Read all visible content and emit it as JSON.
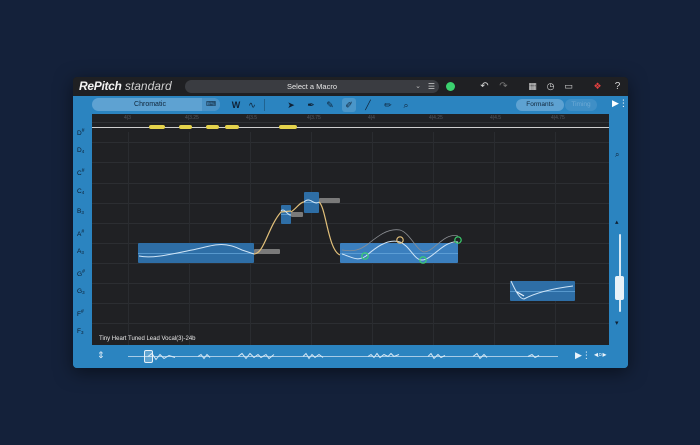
{
  "app": {
    "title_bold": "RePitch",
    "title_light": "standard"
  },
  "macro": {
    "label": "Select a Macro",
    "chevron_icon": "chevron-down-icon",
    "settings_icon": "sliders-icon"
  },
  "titlebar": {
    "status_color": "#3bd16f",
    "icons": [
      "undo-icon",
      "redo-icon",
      "grid-icon",
      "clock-icon",
      "monitor-icon",
      "plugin-badge-icon",
      "help-icon"
    ],
    "help_label": "?"
  },
  "toolbar": {
    "scale": "Chromatic",
    "formants_label": "Formants",
    "timing_label": "Timing",
    "tools": [
      "wave-tool-icon",
      "audio-tool-icon",
      "pointer-tool-icon",
      "pitch-pen-icon",
      "pencil-icon",
      "smooth-brush-icon",
      "line-tool-icon",
      "edit-tool-icon",
      "zoom-icon"
    ]
  },
  "notes": [
    {
      "letter": "D",
      "sup": "#",
      "sub": ""
    },
    {
      "letter": "D",
      "sup": "",
      "sub": "4"
    },
    {
      "letter": "C",
      "sup": "#",
      "sub": ""
    },
    {
      "letter": "C",
      "sup": "",
      "sub": "4"
    },
    {
      "letter": "B",
      "sup": "",
      "sub": "3"
    },
    {
      "letter": "A",
      "sup": "#",
      "sub": ""
    },
    {
      "letter": "A",
      "sup": "",
      "sub": "3"
    },
    {
      "letter": "G",
      "sup": "#",
      "sub": ""
    },
    {
      "letter": "G",
      "sup": "",
      "sub": "3"
    },
    {
      "letter": "F",
      "sup": "#",
      "sub": ""
    },
    {
      "letter": "F",
      "sup": "",
      "sub": "3"
    }
  ],
  "ruler": [
    "4|3",
    "4|3.25",
    "4|3.5",
    "4|3.75",
    "4|4",
    "4|4.25",
    "4|4.5",
    "4|4.75"
  ],
  "editor": {
    "track_name": "Tiny Heart Tuned Lead Vocal(3)-24b",
    "accent_color": "#2b84c0",
    "curve_color": "#e2c07a",
    "node_color": "#3bd16f"
  }
}
